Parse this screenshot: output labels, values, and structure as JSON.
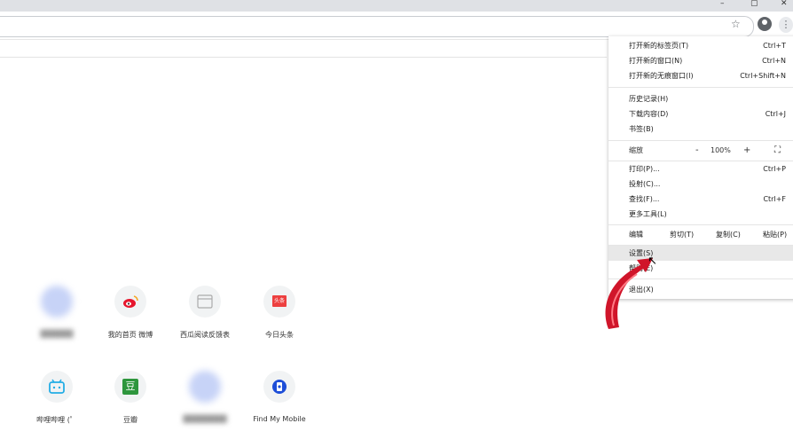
{
  "window": {
    "minimize_glyph": "–",
    "maximize_glyph": "▢",
    "close_glyph": "✕"
  },
  "toolbar": {
    "star_glyph": "☆",
    "menu_glyph": "⋮"
  },
  "shortcuts": [
    {
      "label": "",
      "icon": "blurred-site-icon",
      "blurred": true
    },
    {
      "label": "我的首页 微博",
      "icon": "weibo-icon"
    },
    {
      "label": "西瓜阅读反馈表",
      "icon": "xigua-icon"
    },
    {
      "label": "今日头条",
      "icon": "toutiao-icon",
      "icon_text": "头条"
    },
    {
      "label": "哔哩哔哩 (゜",
      "icon": "bilibili-icon"
    },
    {
      "label": "豆瓣",
      "icon": "douban-icon",
      "icon_text": "豆"
    },
    {
      "label": "",
      "icon": "blurred-site-icon",
      "blurred": true
    },
    {
      "label": "Find My Mobile",
      "icon": "find-my-mobile-icon"
    }
  ],
  "menu": {
    "new_tab": {
      "label": "打开新的标签页(T)",
      "shortcut": "Ctrl+T"
    },
    "new_window": {
      "label": "打开新的窗口(N)",
      "shortcut": "Ctrl+N"
    },
    "new_incognito": {
      "label": "打开新的无痕窗口(I)",
      "shortcut": "Ctrl+Shift+N"
    },
    "history": {
      "label": "历史记录(H)"
    },
    "downloads": {
      "label": "下载内容(D)",
      "shortcut": "Ctrl+J"
    },
    "bookmarks": {
      "label": "书签(B)"
    },
    "zoom": {
      "label": "缩放",
      "minus": "-",
      "value": "100%",
      "plus": "+",
      "fullscreen_glyph": "⛶"
    },
    "print": {
      "label": "打印(P)...",
      "shortcut": "Ctrl+P"
    },
    "cast": {
      "label": "投射(C)..."
    },
    "find": {
      "label": "查找(F)...",
      "shortcut": "Ctrl+F"
    },
    "more_tools": {
      "label": "更多工具(L)"
    },
    "edit": {
      "label": "编辑",
      "cut": "剪切(T)",
      "copy": "复制(C)",
      "paste": "粘贴(P)"
    },
    "settings": {
      "label": "设置(S)"
    },
    "help": {
      "label": "帮助(E)"
    },
    "exit": {
      "label": "退出(X)"
    }
  },
  "colors": {
    "accent_arrow": "#d0152a",
    "highlight": "#e8e8e8"
  }
}
